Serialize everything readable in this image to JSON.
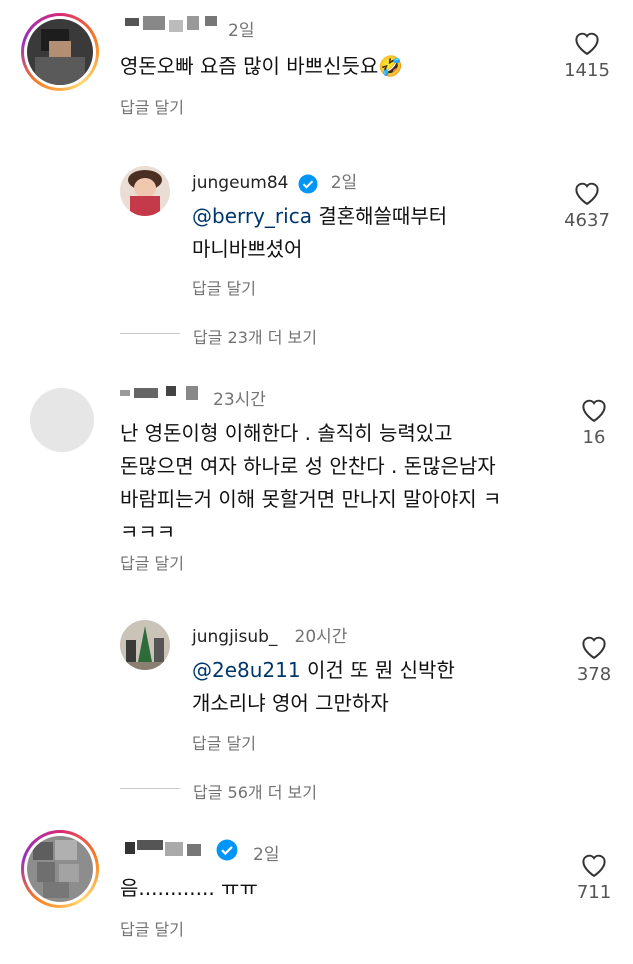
{
  "comments": [
    {
      "time": "2일",
      "text": "영돈오빠 요즘 많이 바쁘신듯요🤣",
      "reply_label": "답글 달기",
      "likes": "1415",
      "reply": {
        "username": "jungeum84",
        "time": "2일",
        "mention": "@berry_rica",
        "text": " 결혼해쓸때부터\n마니바쁘셨어",
        "reply_label": "답글 달기",
        "likes": "4637"
      },
      "more_replies": "답글 23개 더 보기"
    },
    {
      "time": "23시간",
      "text": "난 영돈이형 이해한다 . 솔직히 능력있고\n돈많으면 여자 하나로 성 안찬다 .  돈많은남자\n바람피는거 이해 못할거면 만나지 말아야지 ㅋ\nㅋㅋㅋ",
      "reply_label": "답글 달기",
      "likes": "16",
      "reply": {
        "username": "jungjisub_",
        "time": "20시간",
        "mention": "@2e8u211",
        "text": " 이건 또 뭔 신박한\n개소리냐 영어 그만하자",
        "reply_label": "답글 달기",
        "likes": "378"
      },
      "more_replies": "답글 56개 더 보기"
    },
    {
      "time": "2일",
      "text": "음............ ㅠㅠ",
      "reply_label": "답글 달기",
      "likes": "711"
    }
  ],
  "colors": {
    "verified": "#0095f6",
    "mention": "#00376b",
    "muted": "#737373"
  }
}
